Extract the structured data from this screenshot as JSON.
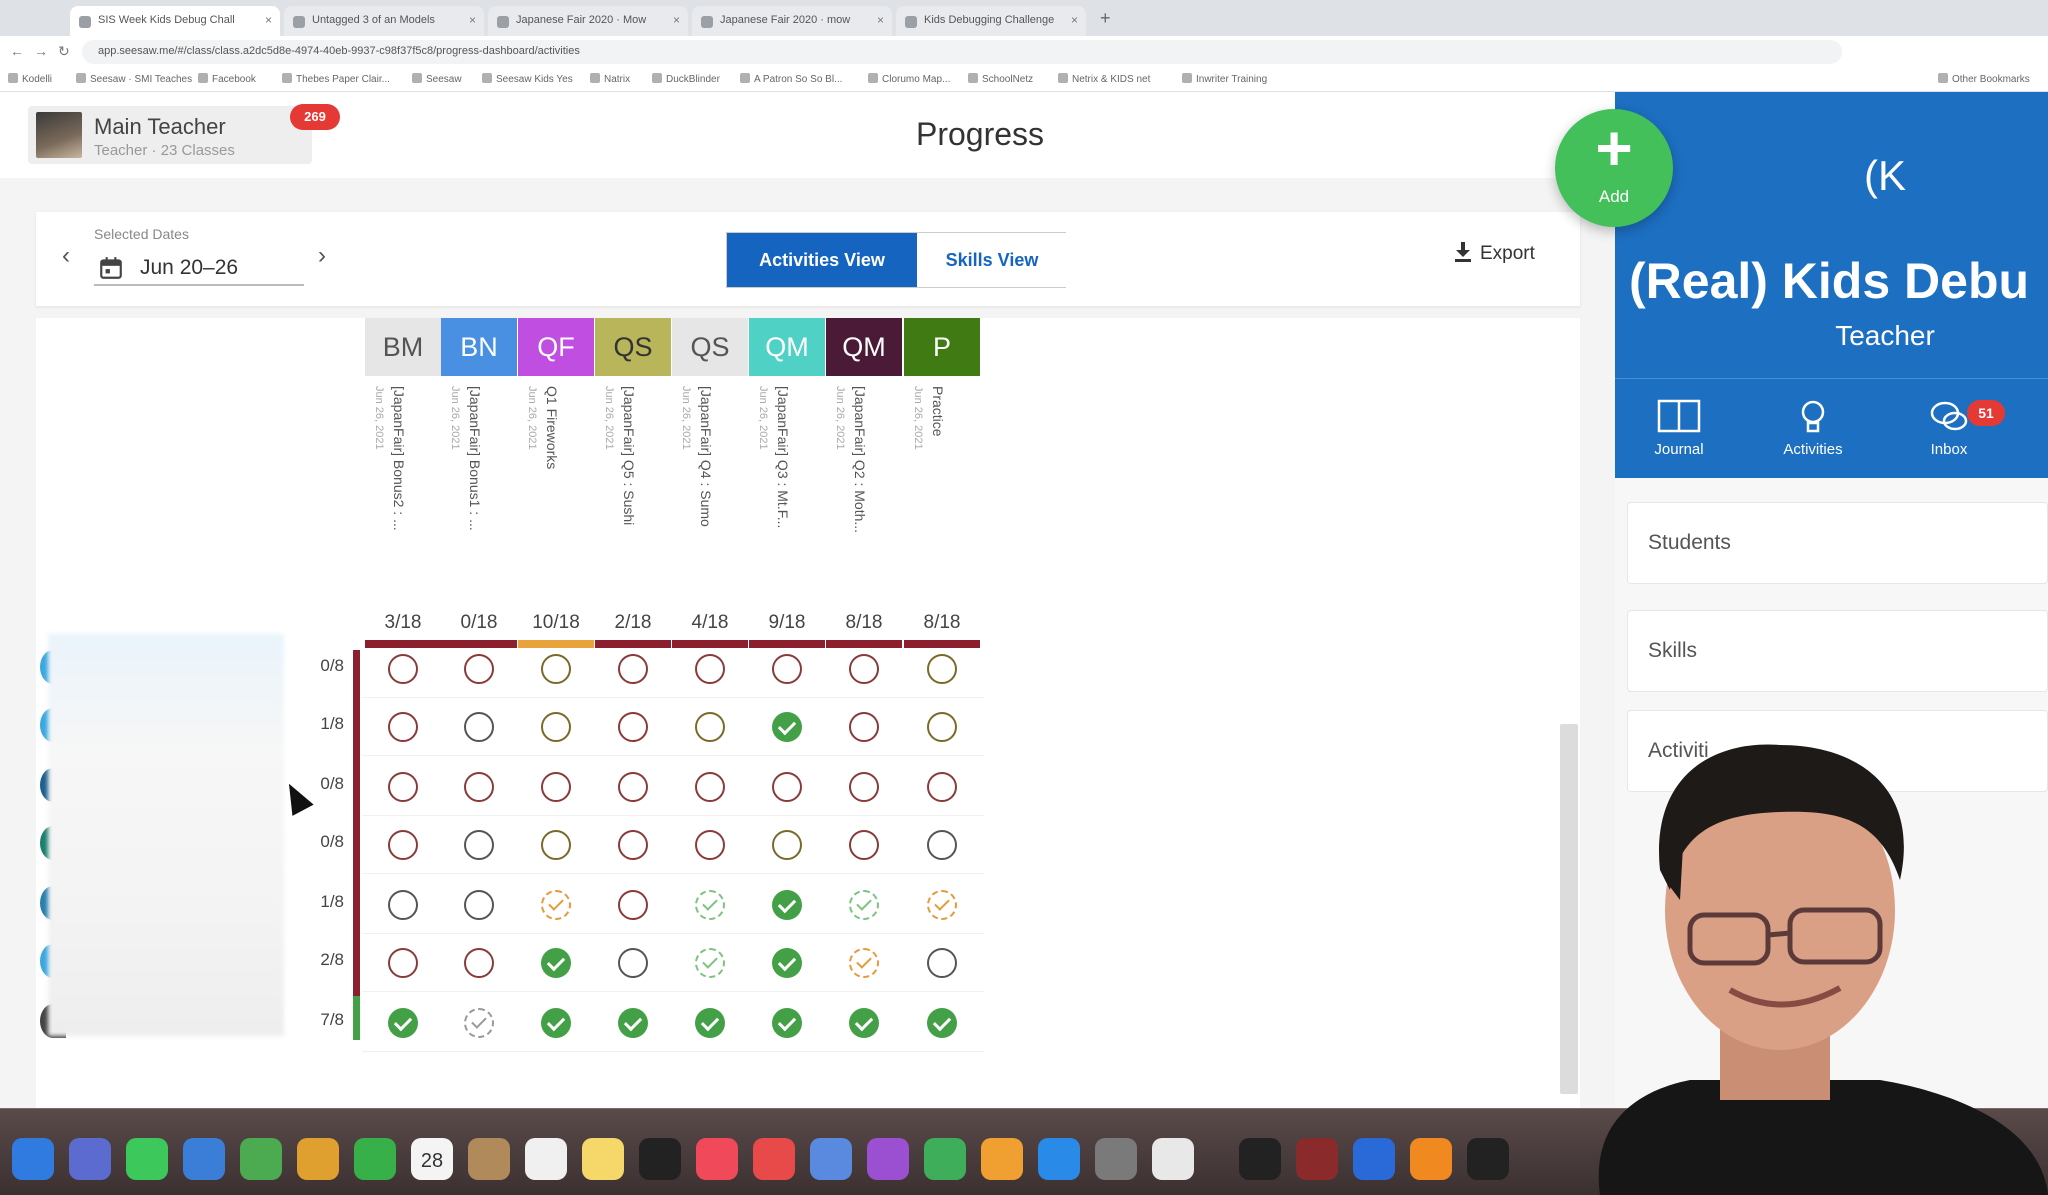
{
  "browser": {
    "tabs": [
      {
        "label": "SIS Week Kids Debug Chall"
      },
      {
        "label": "Untagged 3 of an Models"
      },
      {
        "label": "Japanese Fair 2020 · Mow"
      },
      {
        "label": "Japanese Fair 2020 · mow"
      },
      {
        "label": "Kids Debugging Challenge"
      }
    ],
    "new_tab": "+",
    "url": "app.seesaw.me/#/class/class.a2dc5d8e-4974-40eb-9937-c98f37f5c8/progress-dashboard/activities",
    "bookmarks": [
      "Kodelli",
      "Seesaw · SMI Teaches",
      "Facebook",
      "Thebes Paper Clair...",
      "Seesaw",
      "Seesaw Kids Yes",
      "Natrix",
      "DuckBlinder",
      "A Patron So So Bl...",
      "Clorumo Map...",
      "SchoolNetz",
      "Netrix & KIDS net",
      "Inwriter Training",
      "Other Bookmarks"
    ]
  },
  "header": {
    "teacher_name": "Main Teacher",
    "teacher_subtitle": "Teacher · 23 Classes",
    "notification_count": "269",
    "page_title": "Progress",
    "add_label": "Add",
    "add_plus": "+"
  },
  "filter": {
    "dates_caption": "Selected Dates",
    "date_range": "Jun 20–26",
    "prev": "‹",
    "next": "›",
    "activities_view": "Activities View",
    "skills_view": "Skills View",
    "export": "Export"
  },
  "columns": [
    {
      "code": "BM",
      "title": "[JapanFair] Bonus2 : ...",
      "date": "Jun 26, 2021",
      "score": "3/18",
      "bg": "#e6e6e6",
      "fg": "#555555",
      "bar": "#8c1f2d"
    },
    {
      "code": "BN",
      "title": "[JapanFair] Bonus1 : ...",
      "date": "Jun 26, 2021",
      "score": "0/18",
      "bg": "#4a90e2",
      "fg": "#ffffff",
      "bar": "#8c1f2d"
    },
    {
      "code": "QF",
      "title": "Q1 Fireworks",
      "date": "Jun 26, 2021",
      "score": "10/18",
      "bg": "#c04ee0",
      "fg": "#ffffff",
      "bar": "#e8a33c"
    },
    {
      "code": "QS",
      "title": "[JapanFair] Q5 : Sushi",
      "date": "Jun 26, 2021",
      "score": "2/18",
      "bg": "#b8b55a",
      "fg": "#333333",
      "bar": "#8c1f2d"
    },
    {
      "code": "QS",
      "title": "[JapanFair] Q4 : Sumo",
      "date": "Jun 26, 2021",
      "score": "4/18",
      "bg": "#e6e6e6",
      "fg": "#555555",
      "bar": "#8c1f2d"
    },
    {
      "code": "QM",
      "title": "[JapanFair] Q3 : Mt.F...",
      "date": "Jun 26, 2021",
      "score": "9/18",
      "bg": "#4fd1c5",
      "fg": "#ffffff",
      "bar": "#8c1f2d"
    },
    {
      "code": "QM",
      "title": "[JapanFair] Q2 : Moth...",
      "date": "Jun 26, 2021",
      "score": "8/18",
      "bg": "#4a1a36",
      "fg": "#ffffff",
      "bar": "#8c1f2d"
    },
    {
      "code": "P",
      "title": "Practice",
      "date": "Jun 26, 2021",
      "score": "8/18",
      "bg": "#3f7a12",
      "fg": "#ffffff",
      "bar": "#8c1f2d"
    }
  ],
  "rows": [
    {
      "score": "0/8",
      "avatar": "#3aa7e0",
      "cells": [
        "empty",
        "empty",
        "empty-ol",
        "empty",
        "empty",
        "empty",
        "empty",
        "empty-ol"
      ]
    },
    {
      "score": "1/8",
      "avatar": "#3aa7e0",
      "cells": [
        "empty",
        "empty-dark",
        "empty-ol",
        "empty",
        "empty-ol",
        "done",
        "empty",
        "empty-ol"
      ]
    },
    {
      "score": "0/8",
      "avatar": "#1f5f8f",
      "cells": [
        "empty",
        "empty",
        "empty",
        "empty",
        "empty",
        "empty",
        "empty",
        "empty"
      ]
    },
    {
      "score": "0/8",
      "avatar": "#1a7f6f",
      "cells": [
        "empty",
        "empty-dark",
        "empty-ol",
        "empty",
        "empty",
        "empty-ol",
        "empty",
        "empty-dark"
      ]
    },
    {
      "score": "1/8",
      "avatar": "#2a7fb0",
      "cells": [
        "empty-dark",
        "empty-dark",
        "partial",
        "empty",
        "partial-green",
        "done",
        "partial-green",
        "partial"
      ]
    },
    {
      "score": "2/8",
      "avatar": "#3aa7e0",
      "cells": [
        "empty",
        "empty",
        "done",
        "empty-dark",
        "partial-green",
        "done",
        "partial",
        "empty-dark"
      ]
    },
    {
      "score": "7/8",
      "avatar": "#444444",
      "cells": [
        "done",
        "partial-grey",
        "done",
        "done",
        "done",
        "done",
        "done",
        "done"
      ]
    }
  ],
  "side_panel": {
    "initial": "(K",
    "class_name": "(Real) Kids Debu",
    "role": "Teacher",
    "nav": [
      {
        "label": "Journal",
        "icon": "journal-icon"
      },
      {
        "label": "Activities",
        "icon": "lightbulb-icon"
      },
      {
        "label": "Inbox",
        "icon": "inbox-icon"
      }
    ],
    "inbox_count": "51",
    "sections": [
      "Students",
      "Skills",
      "Activiti"
    ]
  },
  "colors": {
    "brand_blue": "#1565c0",
    "panel_blue": "#1d6fc2",
    "add_green": "#43c05a",
    "done_green": "#43a047",
    "badge_red": "#e53935"
  },
  "dock": {
    "calendar_day": "28",
    "icons": [
      "finder-icon",
      "launchpad-icon",
      "messages-icon",
      "mail-icon",
      "maps-icon",
      "photos-icon",
      "facetime-icon",
      "calendar-icon",
      "contacts-icon",
      "reminders-icon",
      "notes-icon",
      "tv-icon",
      "music-icon",
      "news-icon",
      "keynote-icon",
      "podcasts-icon",
      "numbers-icon",
      "pages-icon",
      "app-store-icon",
      "system-preferences-icon",
      "chrome-icon",
      "github-icon",
      "dictionary-icon",
      "bluetooth-icon",
      "vlc-icon",
      "terminal-icon"
    ]
  }
}
